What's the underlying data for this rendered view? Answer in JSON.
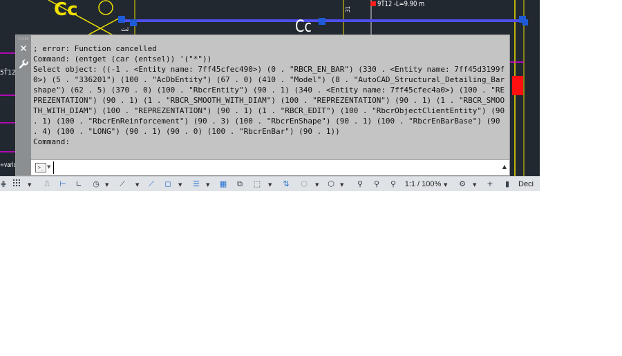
{
  "canvas": {
    "bar_label": "9Ť12 -L=9.90 m",
    "left_label_1": "5Ť12",
    "left_label_2": "=vario",
    "cc_label": "Cc",
    "rotated_label": "31",
    "colors": {
      "background": "#212830",
      "bar": "#4f4ff0",
      "yellow": "#f0e000",
      "magenta": "#e000e0",
      "grip": "#1f5bd6",
      "red": "#ff1010"
    }
  },
  "command_window": {
    "history": "; error: Function cancelled\nCommand: (entget (car (entsel)) '(\"*\"))\nSelect object: ((-1 . <Entity name: 7ff45cfec490>) (0 . \"RBCR_EN_BAR\") (330 . <Entity name: 7ff45d3199f0>) (5 . \"336201\") (100 . \"AcDbEntity\") (67 . 0) (410 . \"Model\") (8 . \"AutoCAD_Structural_Detailing_Bar shape\") (62 . 5) (370 . 0) (100 . \"RbcrEntity\") (90 . 1) (340 . <Entity name: 7ff45cfec4a0>) (100 . \"REPREZENTATION\") (90 . 1) (1 . \"RBCR_SMOOTH_WITH_DIAM\") (100 . \"REPREZENTATION\") (90 . 1) (1 . \"RBCR_SMOOTH_WITH_DIAM\") (100 . \"REPREZENTATION\") (90 . 1) (1 . \"RBCR_EDIT\") (100 . \"RbcrObjectClientEntity\") (90 . 1) (100 . \"RbcrEnReinforcement\") (90 . 3) (100 . \"RbcrEnShape\") (90 . 1) (100 . \"RbcrEnBarBase\") (90 . 4) (100 . \"LONG\") (90 . 1) (90 . 0) (100 . \"RbcrEnBar\") (90 . 1))\nCommand:",
    "input_value": "",
    "prompt_icon_text": ">_"
  },
  "status_bar": {
    "scale": "1:1 / 100%",
    "units": "Deci"
  }
}
